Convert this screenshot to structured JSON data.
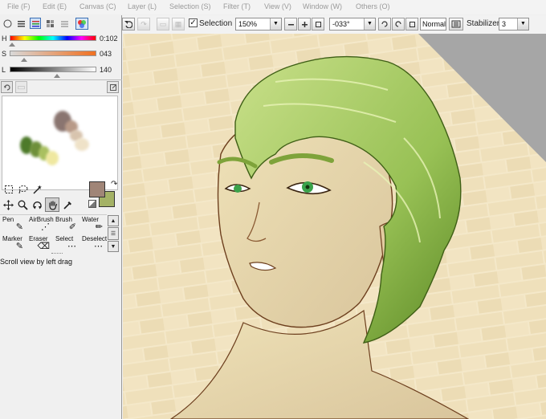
{
  "menu": [
    {
      "label": "File (F)"
    },
    {
      "label": "Edit (E)"
    },
    {
      "label": "Canvas (C)"
    },
    {
      "label": "Layer (L)"
    },
    {
      "label": "Selection (S)"
    },
    {
      "label": "Filter (T)"
    },
    {
      "label": "View (V)"
    },
    {
      "label": "Window (W)"
    },
    {
      "label": "Others (O)"
    }
  ],
  "toolbar": {
    "selection_label": "Selection",
    "selection_checked": true,
    "zoom": "150%",
    "rotation": "-033°",
    "blend_mode": "Normal",
    "stabilizer_label": "Stabilizer",
    "stabilizer_value": "3"
  },
  "color_sliders": [
    {
      "label": "H",
      "value": "0:102",
      "level": 0.03
    },
    {
      "label": "S",
      "value": "043",
      "level": 0.17
    },
    {
      "label": "L",
      "value": "140",
      "level": 0.55
    }
  ],
  "colors": {
    "primary": "#a08577",
    "secondary": "#a4b266",
    "hair_light": "#b9d77a",
    "hair_dark": "#5f8a2a",
    "skin": "#e7d4a7",
    "wall": "#f3e6c6"
  },
  "tools": [
    "rect-select-icon",
    "lasso-icon",
    "magic-wand-icon",
    "move-icon",
    "zoom-icon",
    "rotate-icon",
    "hand-icon",
    "eyedropper-icon"
  ],
  "brushes": [
    {
      "label": "Pen",
      "icon": "pen-icon"
    },
    {
      "label": "AirBrush",
      "icon": "airbrush-icon"
    },
    {
      "label": "Brush",
      "icon": "brush-icon"
    },
    {
      "label": "Water",
      "icon": "water-icon"
    },
    {
      "label": "Marker",
      "icon": "marker-icon"
    },
    {
      "label": "Eraser",
      "icon": "eraser-icon"
    },
    {
      "label": "Select",
      "icon": "select-icon"
    },
    {
      "label": "Deselect",
      "icon": "deselect-icon"
    }
  ],
  "status_text": "Scroll view by left drag"
}
